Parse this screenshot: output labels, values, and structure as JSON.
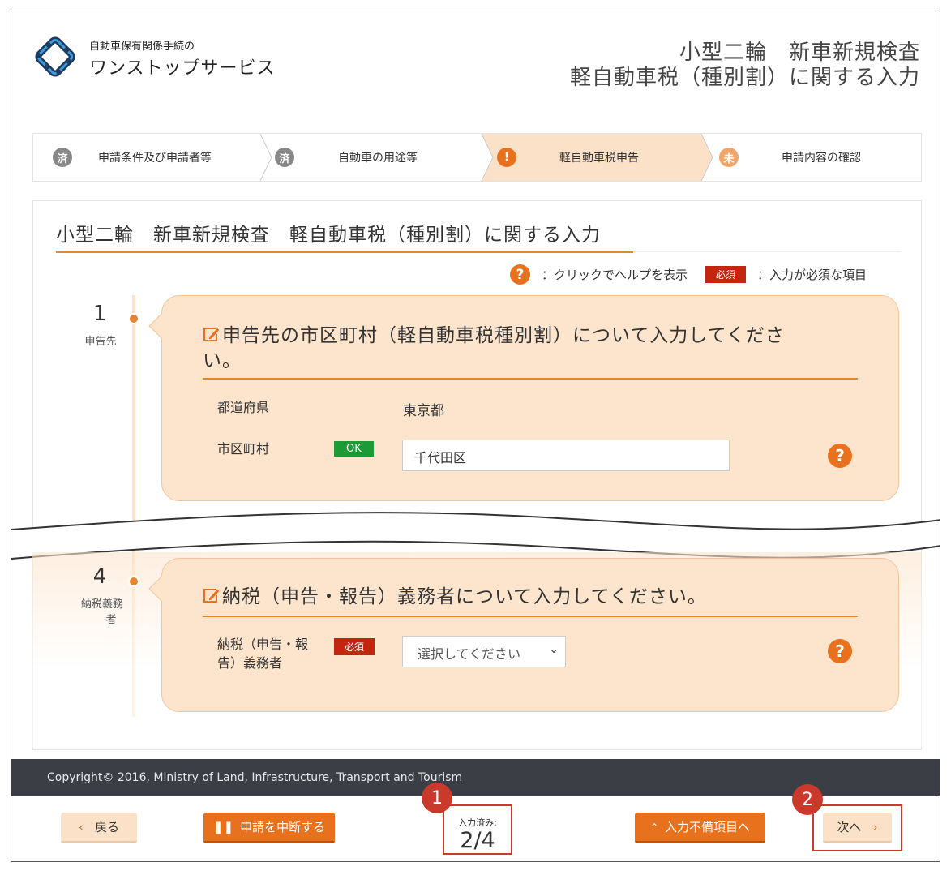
{
  "header": {
    "service_small": "自動車保有関係手続の",
    "service_big": "ワンストップサービス",
    "title_line1": "小型二輪　新車新規検査",
    "title_line2": "軽自動車税（種別割）に関する入力"
  },
  "steps": [
    {
      "badge": "済",
      "label": "申請条件及び申請者等",
      "status": "done"
    },
    {
      "badge": "済",
      "label": "自動車の用途等",
      "status": "done"
    },
    {
      "badge": "!",
      "label": "軽自動車税申告",
      "status": "active"
    },
    {
      "badge": "未",
      "label": "申請内容の確認",
      "status": "pending"
    }
  ],
  "main": {
    "title": "小型二輪　新車新規検査　軽自動車税（種別割）に関する入力",
    "legend_help_icon": "?",
    "legend_help_text": "：クリックでヘルプを表示",
    "legend_required_badge": "必須",
    "legend_required_text": "：入力が必須な項目"
  },
  "section1": {
    "number": "1",
    "caption": "申告先",
    "heading": "申告先の市区町村（軽自動車税種別割）について入力してくださ",
    "heading_cont": "い。",
    "prefecture_label": "都道府県",
    "prefecture_value": "東京都",
    "city_label": "市区町村",
    "city_status": "OK",
    "city_value": "千代田区",
    "help_icon": "?"
  },
  "section4": {
    "number": "4",
    "caption_line1": "納税義務",
    "caption_line2": "者",
    "heading": "納税（申告・報告）義務者について入力してください。",
    "field_label_line1": "納税（申告・報",
    "field_label_line2": "告）義務者",
    "required_badge": "必須",
    "select_value": "選択してください",
    "help_icon": "?"
  },
  "footer": {
    "copyright": "Copyright© 2016, Ministry of Land, Infrastructure, Transport and Tourism",
    "back_label": "戻る",
    "suspend_label": "申請を中断する",
    "progress_label": "入力済み:",
    "progress_value": "2/4",
    "incomplete_label": "入力不備項目へ",
    "next_label": "次へ",
    "callout1": "1",
    "callout2": "2"
  },
  "colors": {
    "accent": "#e8711e",
    "section_bg": "#fde4cc",
    "required": "#c4250f",
    "ok": "#1b9a35",
    "callout": "#c9392c",
    "footer_bg": "#3b3f45"
  }
}
